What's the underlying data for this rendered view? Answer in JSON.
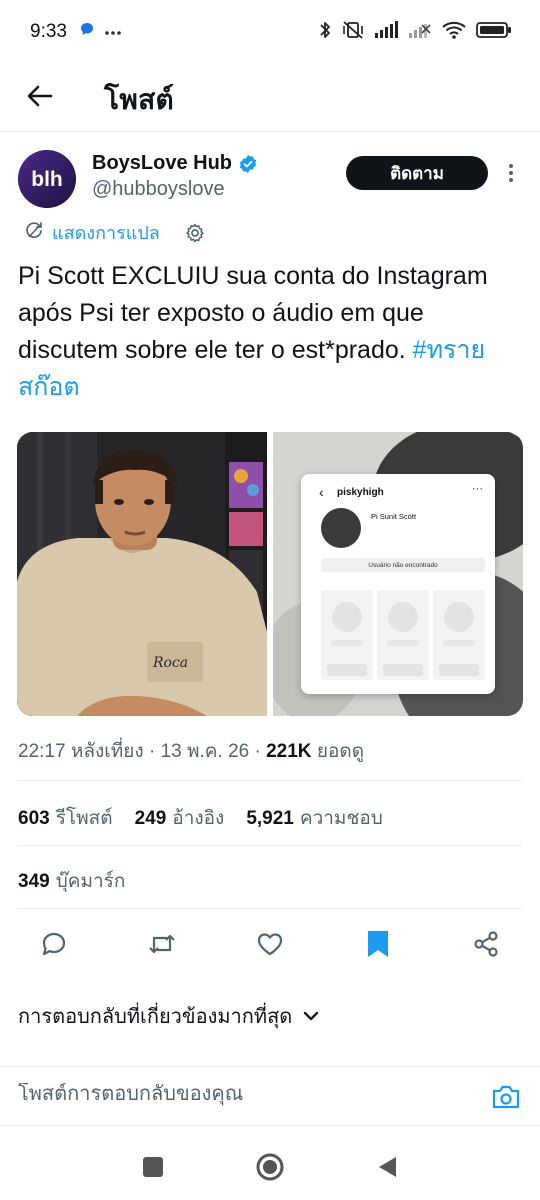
{
  "status_bar": {
    "time": "9:33",
    "left_icons": [
      "chat-bubble-notification-icon",
      "more-dots-icon"
    ],
    "right_icons": [
      "bluetooth-icon",
      "vibrate-off-icon",
      "cell-signal-icon",
      "cell-signal-icon",
      "wifi-icon",
      "battery-icon"
    ]
  },
  "header": {
    "title": "โพสต์"
  },
  "author": {
    "avatar_text": "blh",
    "name": "BoysLove Hub",
    "handle": "@hubboyslove",
    "verified": true,
    "follow_label": "ติดตาม"
  },
  "translate": {
    "label": "แสดงการแปล"
  },
  "tweet": {
    "text": "Pi Scott EXCLUIU sua conta do Instagram após Psi ter exposto o áudio em que discutem sobre ele ter o est*prado.",
    "hashtag": "#ทรายสก๊อต"
  },
  "media": {
    "image_right": {
      "username": "piskyhigh",
      "display_name": "Pi Sunit Scott",
      "not_found": "Usuário não encontrado"
    }
  },
  "meta": {
    "time": "22:17 หลังเที่ยง",
    "date": "13 พ.ค. 26",
    "views_count": "221K",
    "views_label": "ยอดดู"
  },
  "stats": {
    "reposts_count": "603",
    "reposts_label": "รีโพสต์",
    "quotes_count": "249",
    "quotes_label": "อ้างอิง",
    "likes_count": "5,921",
    "likes_label": "ความชอบ",
    "bookmarks_count": "349",
    "bookmarks_label": "บุ๊คมาร์ก"
  },
  "actions": [
    "reply-icon",
    "repost-icon",
    "like-icon",
    "bookmark-icon",
    "share-icon"
  ],
  "replies": {
    "sort_label": "การตอบกลับที่เกี่ยวข้องมากที่สุด"
  },
  "compose": {
    "placeholder": "โพสต์การตอบกลับของคุณ"
  },
  "colors": {
    "accent": "#1d9bf0",
    "text": "#0f1419",
    "secondary": "#536471",
    "follow_bg": "#0f1419",
    "avatar_bg": "#2b1a5c"
  }
}
